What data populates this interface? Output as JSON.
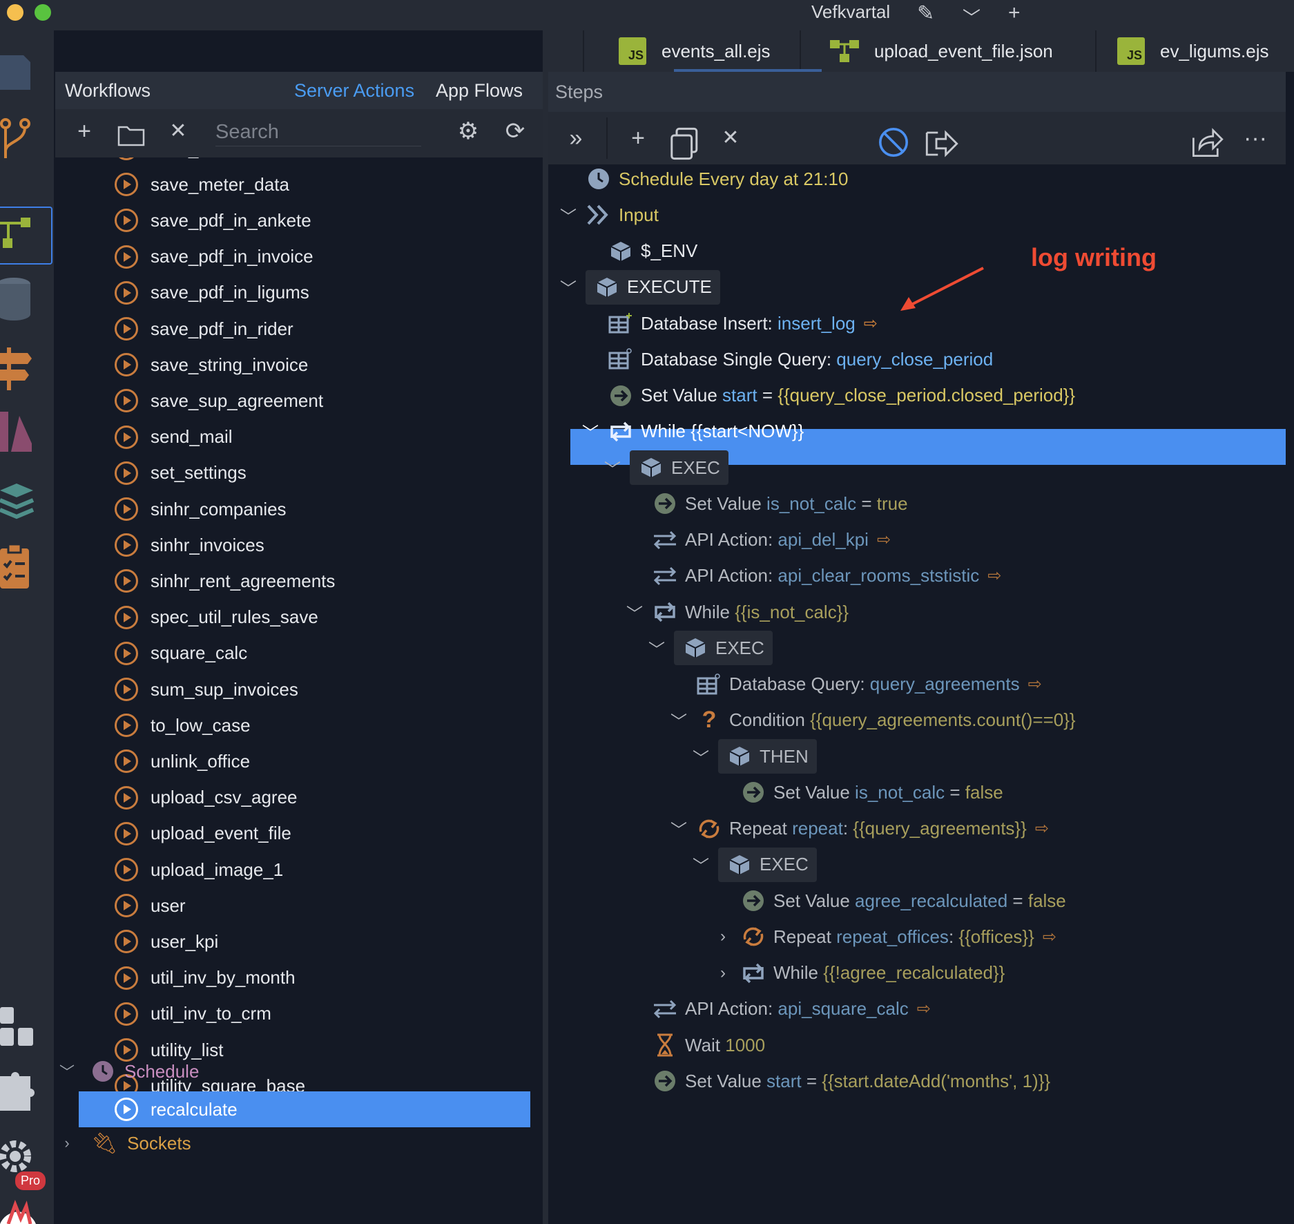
{
  "window": {
    "title": "Vefkvartal",
    "colors": {
      "close": "#f5bf4f",
      "maximize": "#59c33f",
      "accent": "#4a8ff0"
    }
  },
  "activity_icons": [
    "file-icon",
    "branch-icon",
    "workflow-icon",
    "database-icon",
    "signpost-icon",
    "library-icon",
    "layers-icon",
    "clipboard-icon",
    "extensions-icon",
    "puzzle-icon",
    "gear-icon",
    "app-logo-icon"
  ],
  "activity_badge": "Pro",
  "sidebar": {
    "title": "Workflows",
    "tabs": [
      {
        "label": "Server Actions",
        "active": true
      },
      {
        "label": "App Flows",
        "active": false
      }
    ],
    "search_placeholder": "Search",
    "items": [
      "save_meter",
      "save_meter_data",
      "save_pdf_in_ankete",
      "save_pdf_in_invoice",
      "save_pdf_in_ligums",
      "save_pdf_in_rider",
      "save_string_invoice",
      "save_sup_agreement",
      "send_mail",
      "set_settings",
      "sinhr_companies",
      "sinhr_invoices",
      "sinhr_rent_agreements",
      "spec_util_rules_save",
      "square_calc",
      "sum_sup_invoices",
      "to_low_case",
      "unlink_office",
      "upload_csv_agree",
      "upload_event_file",
      "upload_image_1",
      "user",
      "user_kpi",
      "util_inv_by_month",
      "util_inv_to_crm",
      "utility_list",
      "utility_square_base"
    ],
    "schedule_group": "Schedule",
    "schedule_items": [
      "recalculate"
    ],
    "sockets_group": "Sockets"
  },
  "tabs": [
    {
      "label": "events_all.ejs",
      "icon": "JS"
    },
    {
      "label": "upload_event_file.json",
      "icon": "flow"
    },
    {
      "label": "ev_ligums.ejs",
      "icon": "JS"
    }
  ],
  "steps": {
    "title": "Steps",
    "annotation": "log writing",
    "rows": [
      {
        "parts": [
          [
            "Schedule Every day at 21:10",
            "y"
          ]
        ]
      },
      {
        "parts": [
          [
            "Input",
            "y"
          ]
        ]
      },
      {
        "parts": [
          [
            "$_ENV",
            "w"
          ]
        ]
      },
      {
        "parts": [
          [
            "EXECUTE",
            "w"
          ]
        ]
      },
      {
        "parts": [
          [
            "Database Insert: ",
            "w"
          ],
          [
            "insert_log",
            "b"
          ]
        ]
      },
      {
        "parts": [
          [
            "Database Single Query: ",
            "w"
          ],
          [
            "query_close_period",
            "b"
          ]
        ]
      },
      {
        "parts": [
          [
            "Set Value ",
            "w"
          ],
          [
            "start",
            "b"
          ],
          [
            " = ",
            "w"
          ],
          [
            "{{query_close_period.closed_period}}",
            "y"
          ]
        ]
      },
      {
        "parts": [
          [
            "While {{start<NOW}}",
            "w"
          ]
        ]
      },
      {
        "parts": [
          [
            "EXEC",
            "w"
          ]
        ]
      },
      {
        "parts": [
          [
            "Set Value ",
            "w"
          ],
          [
            "is_not_calc",
            "b"
          ],
          [
            " = ",
            "w"
          ],
          [
            "true",
            "y"
          ]
        ]
      },
      {
        "parts": [
          [
            "API Action: ",
            "w"
          ],
          [
            "api_del_kpi",
            "b"
          ]
        ]
      },
      {
        "parts": [
          [
            "API Action: ",
            "w"
          ],
          [
            "api_clear_rooms_ststistic",
            "b"
          ]
        ]
      },
      {
        "parts": [
          [
            "While ",
            "w"
          ],
          [
            "{{is_not_calc}}",
            "y"
          ]
        ]
      },
      {
        "parts": [
          [
            "EXEC",
            "w"
          ]
        ]
      },
      {
        "parts": [
          [
            "Database Query: ",
            "w"
          ],
          [
            "query_agreements",
            "b"
          ]
        ]
      },
      {
        "parts": [
          [
            "Condition ",
            "w"
          ],
          [
            "{{query_agreements.count()==0}}",
            "y"
          ]
        ]
      },
      {
        "parts": [
          [
            "THEN",
            "w"
          ]
        ]
      },
      {
        "parts": [
          [
            "Set Value ",
            "w"
          ],
          [
            "is_not_calc",
            "b"
          ],
          [
            " = ",
            "w"
          ],
          [
            "false",
            "y"
          ]
        ]
      },
      {
        "parts": [
          [
            "Repeat ",
            "w"
          ],
          [
            "repeat",
            "b"
          ],
          [
            ": ",
            "w"
          ],
          [
            "{{query_agreements}}",
            "y"
          ]
        ]
      },
      {
        "parts": [
          [
            "EXEC",
            "w"
          ]
        ]
      },
      {
        "parts": [
          [
            "Set Value ",
            "w"
          ],
          [
            "agree_recalculated",
            "b"
          ],
          [
            " = ",
            "w"
          ],
          [
            "false",
            "y"
          ]
        ]
      },
      {
        "parts": [
          [
            "Repeat ",
            "w"
          ],
          [
            "repeat_offices",
            "b"
          ],
          [
            ": ",
            "w"
          ],
          [
            "{{offices}}",
            "y"
          ]
        ]
      },
      {
        "parts": [
          [
            "While ",
            "w"
          ],
          [
            "{{!agree_recalculated}}",
            "y"
          ]
        ]
      },
      {
        "parts": [
          [
            "API Action: ",
            "w"
          ],
          [
            "api_square_calc",
            "b"
          ]
        ]
      },
      {
        "parts": [
          [
            "Wait ",
            "w"
          ],
          [
            "1000",
            "y"
          ]
        ]
      },
      {
        "parts": [
          [
            "Set Value ",
            "w"
          ],
          [
            "start",
            "b"
          ],
          [
            " = ",
            "w"
          ],
          [
            "{{start.dateAdd('months', 1)}}",
            "y"
          ]
        ]
      }
    ]
  }
}
